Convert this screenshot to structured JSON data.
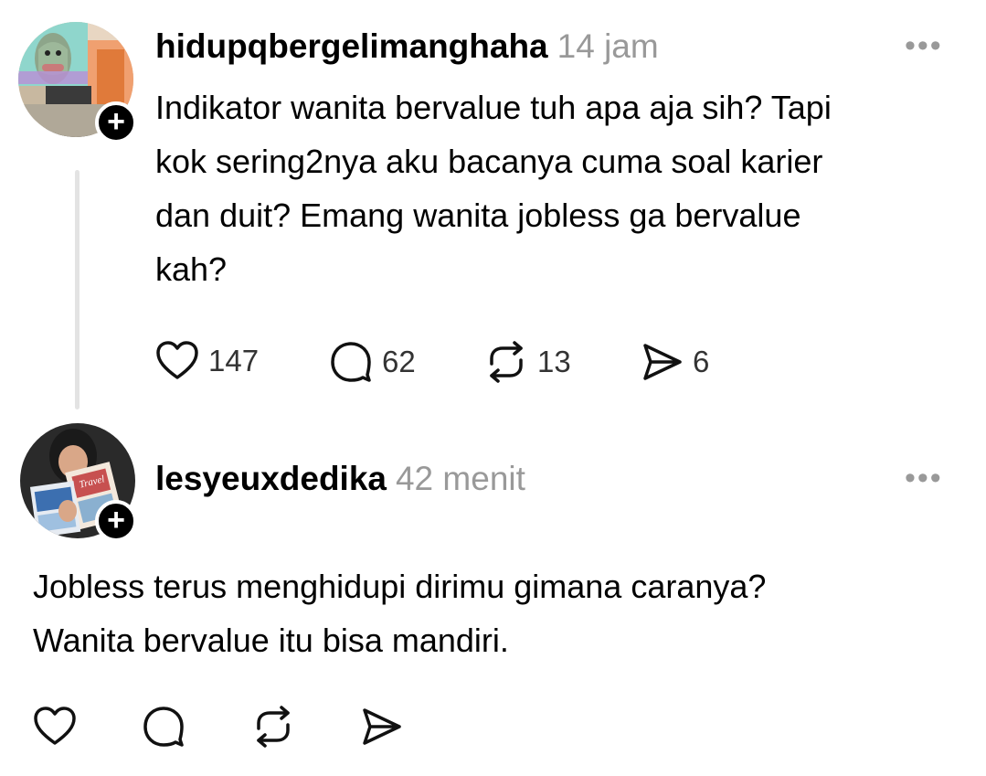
{
  "posts": [
    {
      "username": "hidupqbergelimanghaha",
      "time": "14 jam",
      "text_lines": [
        "Indikator wanita bervalue tuh apa aja sih? Tapi",
        "kok sering2nya aku bacanya cuma soal karier",
        "dan duit? Emang wanita jobless ga bervalue",
        "kah?"
      ],
      "likes": "147",
      "replies": "62",
      "reposts": "13",
      "shares": "6"
    },
    {
      "username": "lesyeuxdedika",
      "time": "42 menit",
      "text_lines": [
        "Jobless terus menghidupi dirimu gimana caranya?",
        "Wanita bervalue itu bisa mandiri."
      ],
      "avatar_book_label": "Travel"
    }
  ],
  "icons": {
    "like": "heart-icon",
    "reply": "speech-bubble-icon",
    "repost": "repost-arrows-icon",
    "share": "send-icon",
    "more": "more-dots-icon",
    "follow": "plus-icon"
  },
  "ui": {
    "more_glyph": "•••",
    "plus_glyph": "+"
  },
  "colors": {
    "text": "#000000",
    "muted": "#999999",
    "count": "#333333",
    "thread_line": "#e3e3e3"
  }
}
